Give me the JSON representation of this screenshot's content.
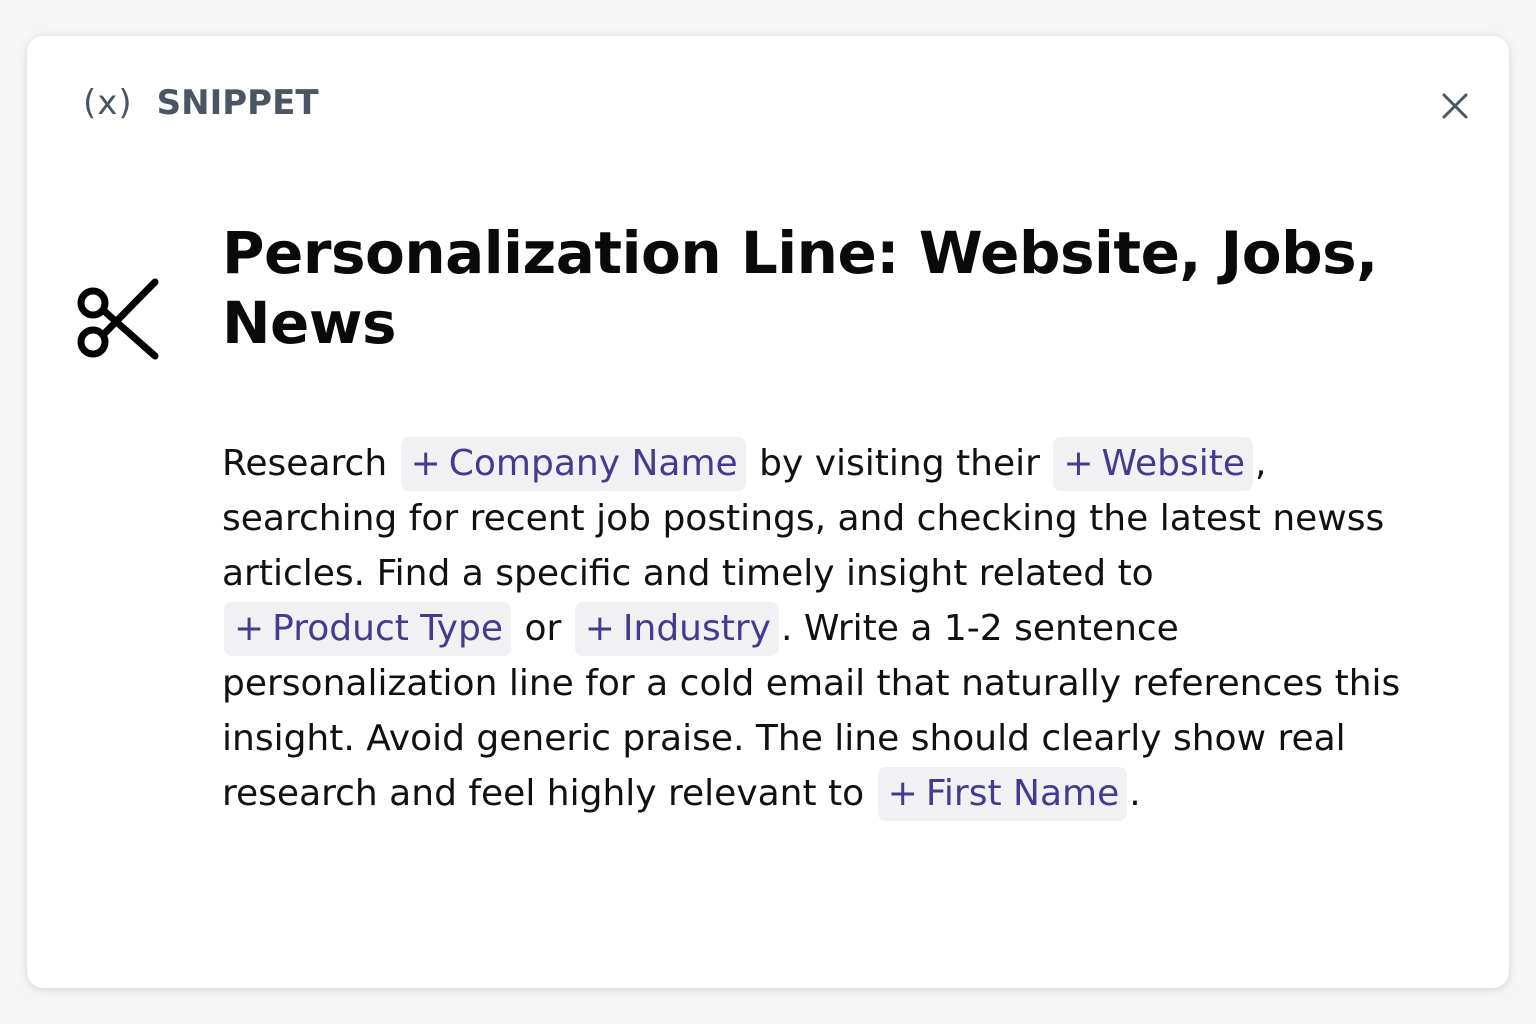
{
  "header": {
    "variable_icon": "(x)",
    "label": "SNIPPET",
    "close_icon": "close-icon"
  },
  "snippet": {
    "icon": "scissors-icon",
    "title": "Personalization Line: Website, Jobs, News",
    "body": {
      "t1": "Research ",
      "v1": "Company Name",
      "t2": " by visiting their ",
      "v2": "Website",
      "t3": ", searching for recent job postings, and checking the latest newss articles. Find a specific and timely insight related to ",
      "v3": "Product Type",
      "t4": " or ",
      "v4": "Industry",
      "t5": ". Write a 1-2 sentence personalization line for a cold email that naturally references this insight. Avoid generic praise. The line should clearly show real research and feel highly relevant to ",
      "v5": "First Name",
      "t6": "."
    },
    "token_prefix": "+"
  },
  "colors": {
    "token_text": "#433b8f",
    "token_bg": "#f1f1f4",
    "header_text": "#4b5563"
  }
}
